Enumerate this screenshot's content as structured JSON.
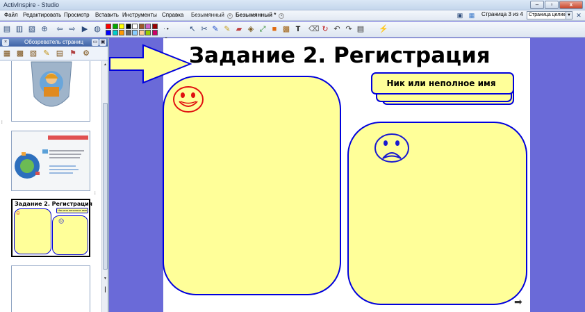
{
  "window": {
    "title": "ActivInspire - Studio"
  },
  "menu": {
    "items": [
      {
        "label": "Файл"
      },
      {
        "label": "Редактировать"
      },
      {
        "label": "Просмотр"
      },
      {
        "label": "Вставить"
      },
      {
        "label": "Инструменты"
      },
      {
        "label": "Справка"
      }
    ],
    "tabs": [
      {
        "label": "Безымянный",
        "active": false
      },
      {
        "label": "Безымянный *",
        "active": true
      }
    ],
    "page_indicator": "Страница 3 из 4",
    "zoom": "Страница целиком"
  },
  "colors": {
    "accent": "#0000dd",
    "panel_fill": "#ffff99",
    "background": "#6a6ad8",
    "happy_face": "#e01010",
    "sad_face": "#1a1ad0"
  },
  "toolbar": {
    "palette": [
      "#ff0000",
      "#00aa00",
      "#ffff00",
      "#000000",
      "#ffffff",
      "#9e5a2a",
      "#cc66cc",
      "#990000",
      "#0000ff",
      "#00cccc",
      "#ff9900",
      "#666666",
      "#88ccff",
      "#ffcc99",
      "#99cc00",
      "#cc0066"
    ]
  },
  "sidebar": {
    "title": "Обозреватель страниц",
    "thumbnails": [
      {
        "id": "thumb-1",
        "caption": ""
      },
      {
        "id": "thumb-2",
        "caption": ""
      },
      {
        "id": "thumb-3",
        "caption": "Задание 2. Регистрация",
        "note": "Ник или неполное имя"
      },
      {
        "id": "thumb-4",
        "caption": ""
      }
    ]
  },
  "page": {
    "title": "Задание 2. Регистрация",
    "nick_label": "Ник или неполное имя"
  }
}
